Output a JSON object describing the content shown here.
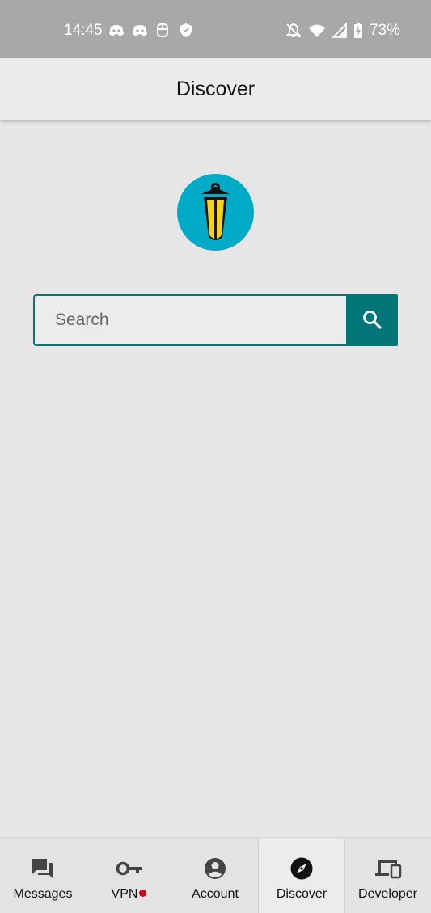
{
  "status_bar": {
    "time": "14:45",
    "battery": "73%",
    "left_icons": [
      "discord-icon",
      "discord-icon",
      "app-icon",
      "shield-check-icon"
    ],
    "right_icons": [
      "bell-off-icon",
      "wifi-icon",
      "signal-icon",
      "battery-charging-icon"
    ]
  },
  "app_bar": {
    "title": "Discover"
  },
  "logo": {
    "icon": "lantern-logo-icon",
    "bg_color": "#00abc8",
    "lantern_color": "#f2d21b"
  },
  "search": {
    "placeholder": "Search",
    "value": "",
    "button_icon": "search-icon",
    "accent": "#007678"
  },
  "bottom_nav": {
    "active": "Discover",
    "items": [
      {
        "label": "Messages",
        "icon": "chat-icon"
      },
      {
        "label": "VPN",
        "icon": "key-icon",
        "badge_color": "#d0021b"
      },
      {
        "label": "Account",
        "icon": "account-circle-icon"
      },
      {
        "label": "Discover",
        "icon": "compass-icon"
      },
      {
        "label": "Developer",
        "icon": "devices-icon"
      }
    ]
  }
}
